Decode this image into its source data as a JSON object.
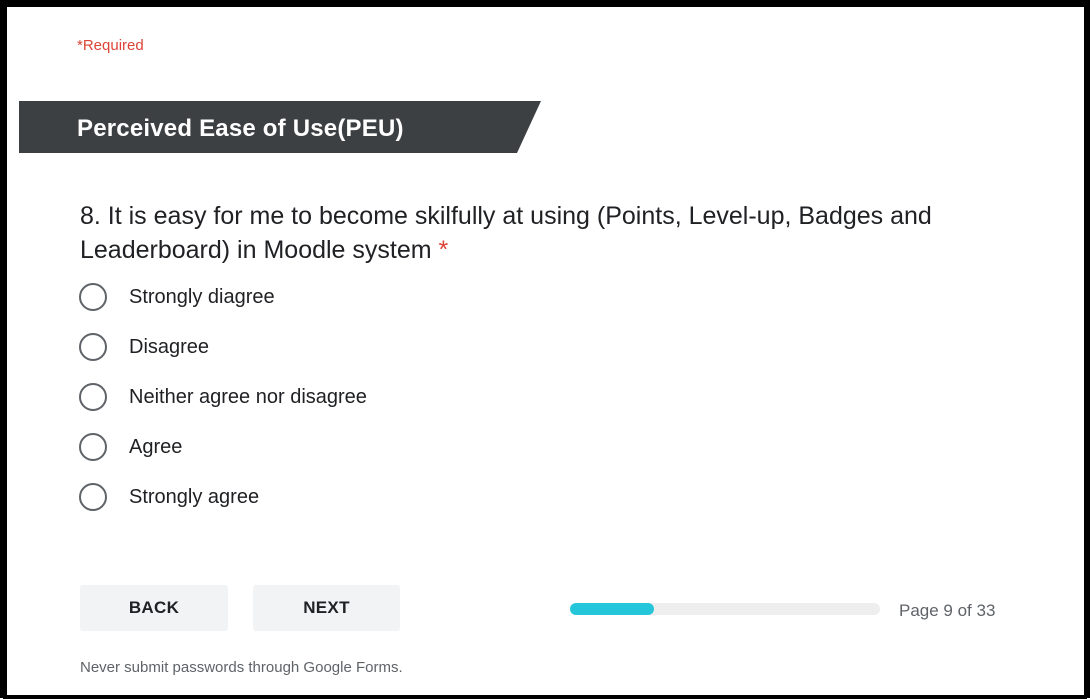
{
  "form": {
    "required_note": "*Required",
    "section_title": "Perceived Ease of Use(PEU)",
    "question": {
      "text": "8. It is easy for me to become skilfully at using (Points, Level-up, Badges and Leaderboard) in Moodle system",
      "required_marker": "*"
    },
    "options": [
      {
        "label": "Strongly diagree",
        "selected": false
      },
      {
        "label": "Disagree",
        "selected": false
      },
      {
        "label": "Neither agree nor disagree",
        "selected": false
      },
      {
        "label": "Agree",
        "selected": false
      },
      {
        "label": "Strongly agree",
        "selected": false
      }
    ],
    "nav": {
      "back_label": "BACK",
      "next_label": "NEXT"
    },
    "progress": {
      "current_page": 9,
      "total_pages": 33,
      "fraction": 0.27,
      "text": "Page 9 of 33"
    },
    "footer_note": "Never submit passwords through Google Forms."
  },
  "colors": {
    "section_banner": "#3c4043",
    "required": "#db4437",
    "progress_fill": "#26c6da",
    "progress_track": "#eeeeee",
    "button_bg": "#f1f3f4"
  }
}
